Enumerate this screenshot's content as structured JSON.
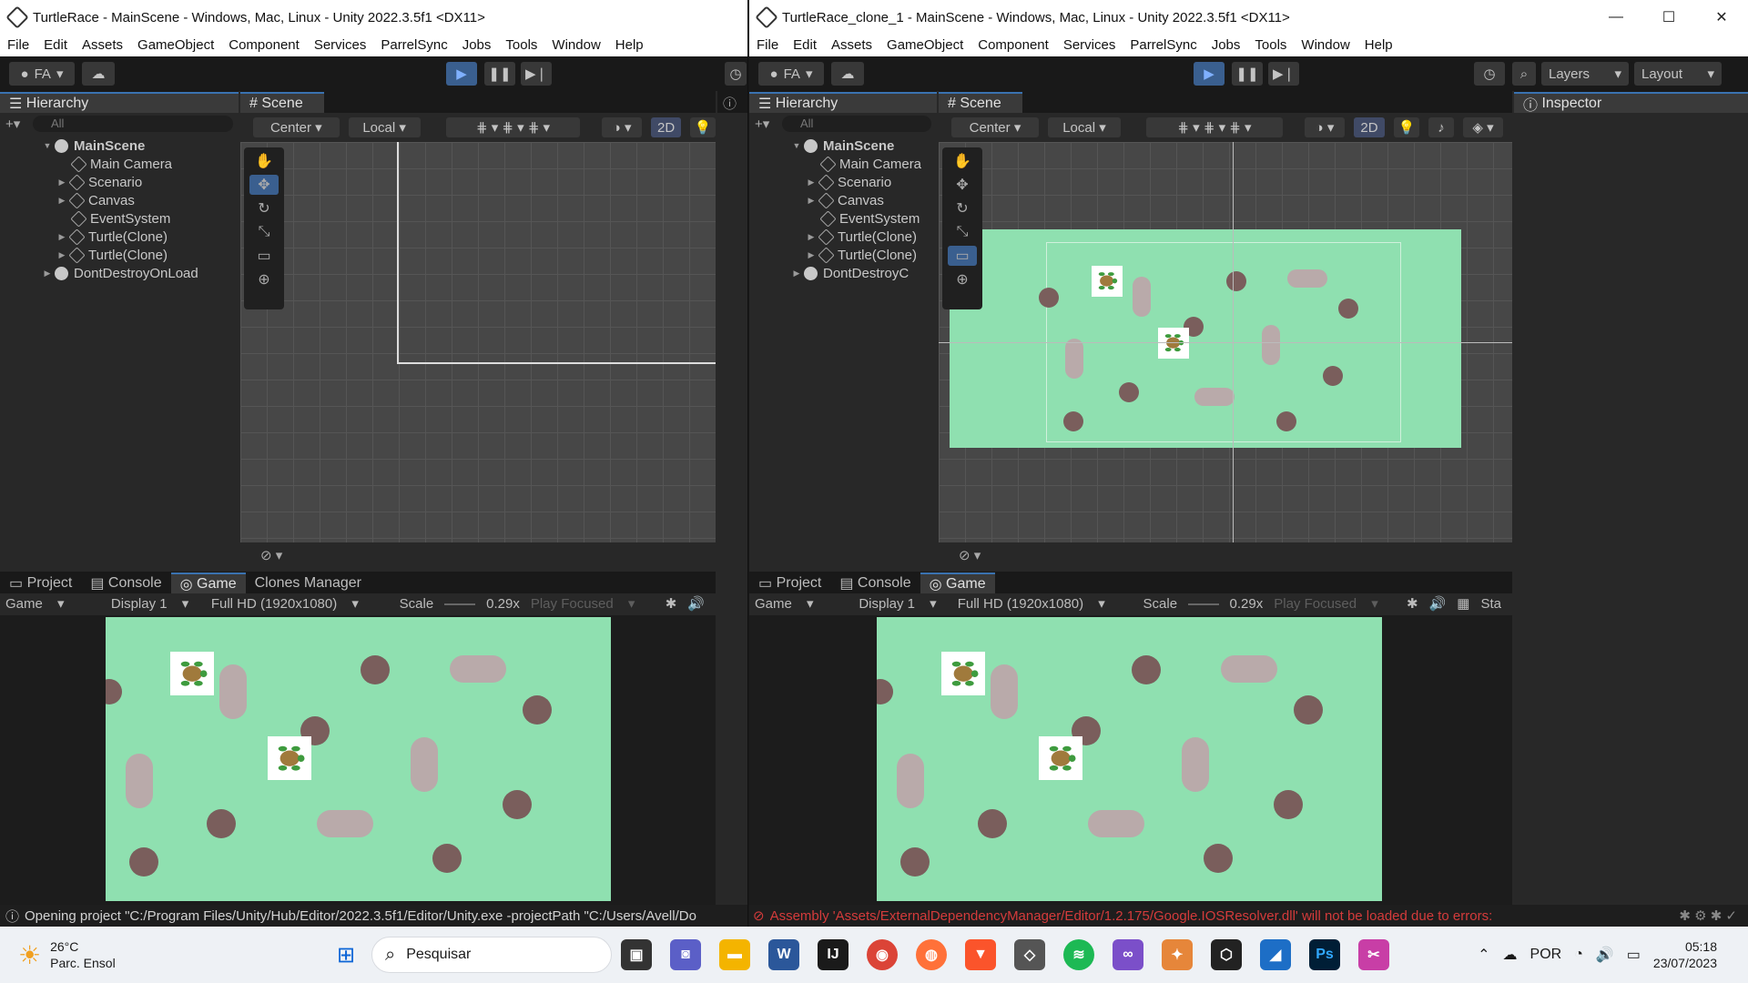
{
  "windows": [
    {
      "title": "TurtleRace - MainScene - Windows, Mac, Linux - Unity 2022.3.5f1 <DX11>",
      "menu": [
        "File",
        "Edit",
        "Assets",
        "GameObject",
        "Component",
        "Services",
        "ParrelSync",
        "Jobs",
        "Tools",
        "Window",
        "Help"
      ],
      "account": "FA",
      "hierarchy": {
        "tab": "Hierarchy",
        "search_placeholder": "All",
        "items": [
          {
            "label": "MainScene",
            "kind": "scene"
          },
          {
            "label": "Main Camera",
            "kind": "object"
          },
          {
            "label": "Scenario",
            "kind": "object",
            "expandable": true
          },
          {
            "label": "Canvas",
            "kind": "object",
            "expandable": true
          },
          {
            "label": "EventSystem",
            "kind": "object"
          },
          {
            "label": "Turtle(Clone)",
            "kind": "object",
            "expandable": true
          },
          {
            "label": "Turtle(Clone)",
            "kind": "object",
            "expandable": true
          },
          {
            "label": "DontDestroyOnLoad",
            "kind": "scene"
          }
        ]
      },
      "scene": {
        "tab": "Scene",
        "pivot": "Center",
        "space": "Local",
        "mode2d": "2D"
      },
      "bottom_tabs": [
        "Project",
        "Console",
        "Game",
        "Clones Manager"
      ],
      "game": {
        "view": "Game",
        "display": "Display 1",
        "resolution": "Full HD (1920x1080)",
        "scale_label": "Scale",
        "scale_value": "0.29x",
        "play_focused": "Play Focused"
      },
      "status": "Opening project \"C:/Program Files/Unity/Hub/Editor/2022.3.5f1/Editor/Unity.exe -projectPath \"C:/Users/Avell/Do"
    },
    {
      "title": "TurtleRace_clone_1 - MainScene - Windows, Mac, Linux - Unity 2022.3.5f1 <DX11>",
      "menu": [
        "File",
        "Edit",
        "Assets",
        "GameObject",
        "Component",
        "Services",
        "ParrelSync",
        "Jobs",
        "Tools",
        "Window",
        "Help"
      ],
      "account": "FA",
      "layers": "Layers",
      "layout": "Layout",
      "hierarchy": {
        "tab": "Hierarchy",
        "search_placeholder": "All",
        "items": [
          {
            "label": "MainScene",
            "kind": "scene"
          },
          {
            "label": "Main Camera",
            "kind": "object"
          },
          {
            "label": "Scenario",
            "kind": "object",
            "expandable": true
          },
          {
            "label": "Canvas",
            "kind": "object",
            "expandable": true
          },
          {
            "label": "EventSystem",
            "kind": "object"
          },
          {
            "label": "Turtle(Clone)",
            "kind": "object",
            "expandable": true
          },
          {
            "label": "Turtle(Clone)",
            "kind": "object",
            "expandable": true
          },
          {
            "label": "DontDestroyC",
            "kind": "scene"
          }
        ]
      },
      "scene": {
        "tab": "Scene",
        "pivot": "Center",
        "space": "Local",
        "mode2d": "2D"
      },
      "inspector": "Inspector",
      "bottom_tabs": [
        "Project",
        "Console",
        "Game"
      ],
      "game": {
        "view": "Game",
        "display": "Display 1",
        "resolution": "Full HD (1920x1080)",
        "scale_label": "Scale",
        "scale_value": "0.29x",
        "play_focused": "Play Focused",
        "stats": "Sta"
      },
      "status": "Assembly 'Assets/ExternalDependencyManager/Editor/1.2.175/Google.IOSResolver.dll' will not be loaded due to errors:",
      "status_color": "#d43b3b"
    }
  ],
  "colors": {
    "game_bg": "#8fe0b0",
    "rock": "#7a5e5c",
    "pill": "#b9aaaa",
    "accent": "#3a72b0"
  },
  "taskbar": {
    "weather_temp": "26°C",
    "weather_desc": "Parc. Ensol",
    "search": "Pesquisar",
    "lang": "POR",
    "time": "05:18",
    "date": "23/07/2023"
  }
}
